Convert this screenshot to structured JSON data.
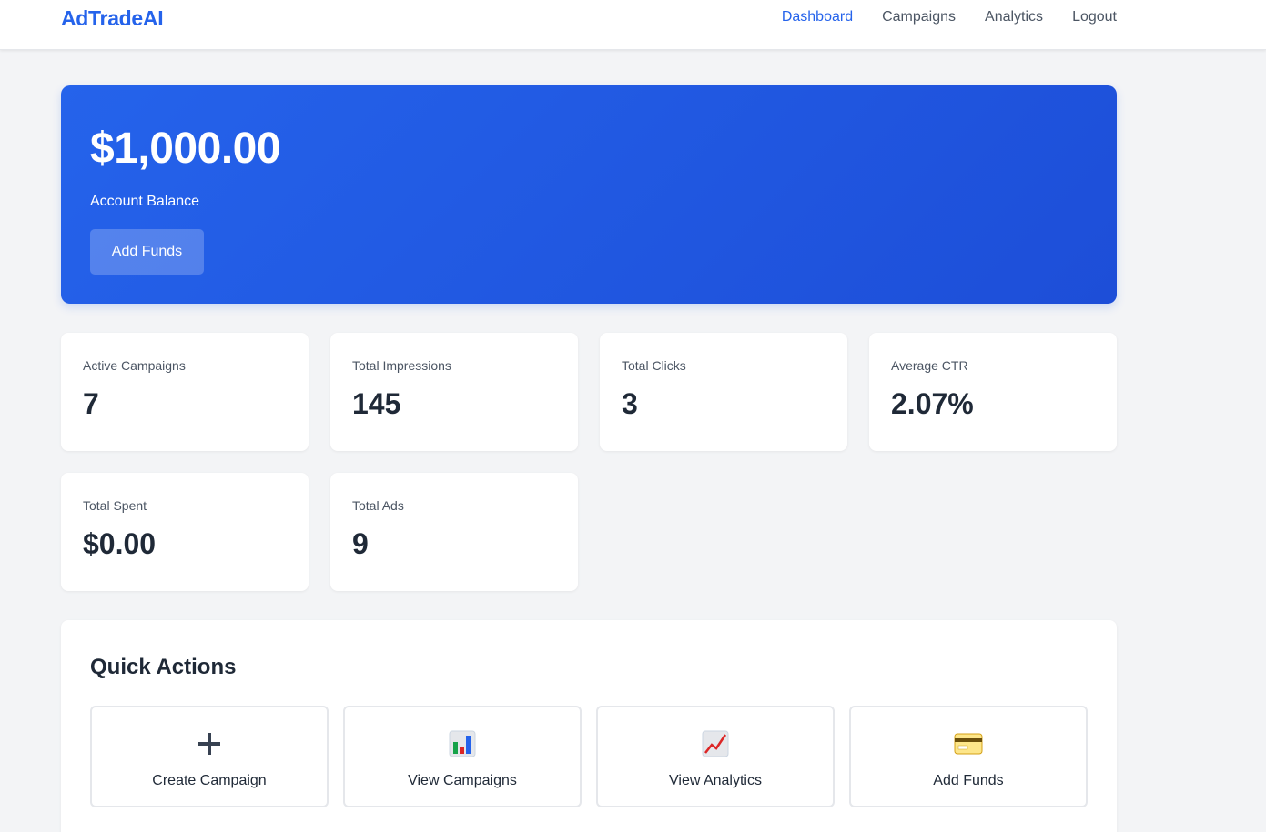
{
  "nav": {
    "brand": "AdTradeAI",
    "links": [
      "Dashboard",
      "Campaigns",
      "Analytics",
      "Logout"
    ],
    "active": "Dashboard"
  },
  "balance": {
    "amount": "$1,000.00",
    "label": "Account Balance",
    "button": "Add Funds"
  },
  "stats": [
    {
      "label": "Active Campaigns",
      "value": "7"
    },
    {
      "label": "Total Impressions",
      "value": "145"
    },
    {
      "label": "Total Clicks",
      "value": "3"
    },
    {
      "label": "Average CTR",
      "value": "2.07%"
    },
    {
      "label": "Total Spent",
      "value": "$0.00"
    },
    {
      "label": "Total Ads",
      "value": "9"
    }
  ],
  "quick_actions": {
    "title": "Quick Actions",
    "items": [
      {
        "label": "Create Campaign",
        "icon": "plus-icon"
      },
      {
        "label": "View Campaigns",
        "icon": "bar-chart-icon"
      },
      {
        "label": "View Analytics",
        "icon": "line-chart-icon"
      },
      {
        "label": "Add Funds",
        "icon": "credit-card-icon"
      }
    ]
  },
  "colors": {
    "primary": "#2563eb",
    "background": "#f3f4f6",
    "text": "#1f2937"
  }
}
